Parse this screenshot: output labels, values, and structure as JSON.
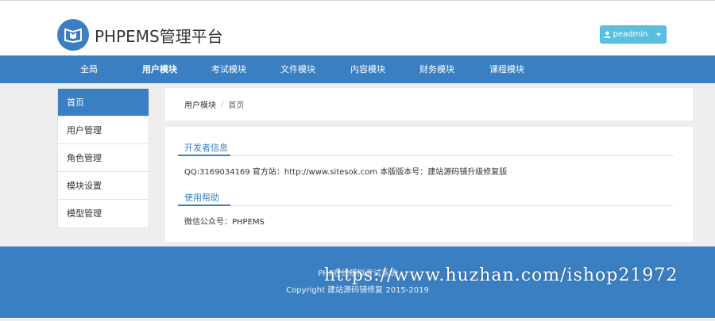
{
  "header": {
    "logo_text": "PHPEMS管理平台",
    "user_label": "peadmin"
  },
  "nav": {
    "items": [
      {
        "label": "全局",
        "active": false
      },
      {
        "label": "用户模块",
        "active": true
      },
      {
        "label": "考试模块",
        "active": false
      },
      {
        "label": "文件模块",
        "active": false
      },
      {
        "label": "内容模块",
        "active": false
      },
      {
        "label": "财务模块",
        "active": false
      },
      {
        "label": "课程模块",
        "active": false
      }
    ]
  },
  "sidebar": {
    "items": [
      {
        "label": "首页",
        "active": true
      },
      {
        "label": "用户管理",
        "active": false
      },
      {
        "label": "角色管理",
        "active": false
      },
      {
        "label": "模块设置",
        "active": false
      },
      {
        "label": "模型管理",
        "active": false
      }
    ]
  },
  "breadcrumb": {
    "parent": "用户模块",
    "separator": "/",
    "current": "首页"
  },
  "main": {
    "developer_title": "开发者信息",
    "developer_body": "QQ:3169034169 官方站：http://www.sitesok.com 本版版本号：建站源码铺升级修复版",
    "help_title": "使用帮助",
    "help_body": "微信公众号：PHPEMS"
  },
  "footer": {
    "line1": "PHP在线模拟考试系统",
    "line2": "Copyright 建站源码铺修复 2015-2019"
  },
  "watermark": "https://www.huzhan.com/ishop21972",
  "colors": {
    "primary": "#3a7fc1",
    "info_button": "#5bc0de",
    "background": "#eeeeee"
  }
}
